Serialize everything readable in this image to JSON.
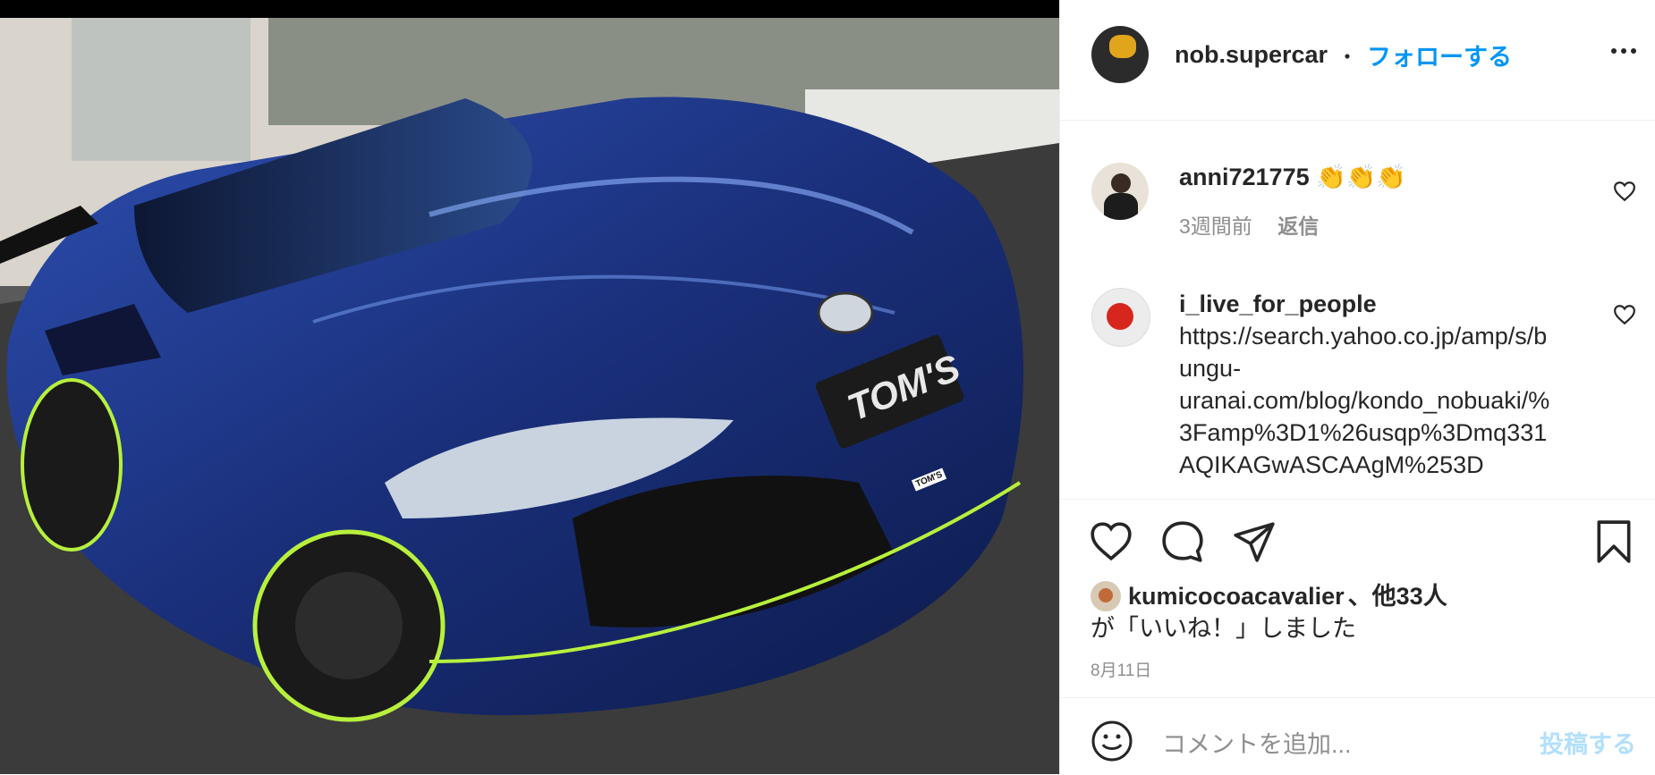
{
  "post": {
    "author": "nob.supercar",
    "separator": "・",
    "follow_label": "フォローする",
    "more_icon": "more-horizontal-icon"
  },
  "photo": {
    "plate_text": "TOM'S",
    "badge_text": "TOM'S",
    "colors": {
      "body": "#1e3a8a",
      "ground": "#3a3a3a",
      "accent": "#b7f03c"
    }
  },
  "comments": [
    {
      "user": "anni721775",
      "text": "👏👏👏",
      "time": "3週間前",
      "reply": "返信"
    },
    {
      "user": "i_live_for_people",
      "lines": [
        "https://search.yahoo.co.jp/amp/s/b",
        "ungu-",
        "uranai.com/blog/kondo_nobuaki/%",
        "3Famp%3D1%26usqp%3Dmq331",
        "AQIKAGwASCAAgM%253D"
      ]
    }
  ],
  "likes": {
    "user": "kumicocoacavalier",
    "suffix": "、他33人",
    "line2": "が「いいね！」しました"
  },
  "date": "8月11日",
  "comment_box": {
    "placeholder": "コメントを追加...",
    "post_label": "投稿する"
  }
}
